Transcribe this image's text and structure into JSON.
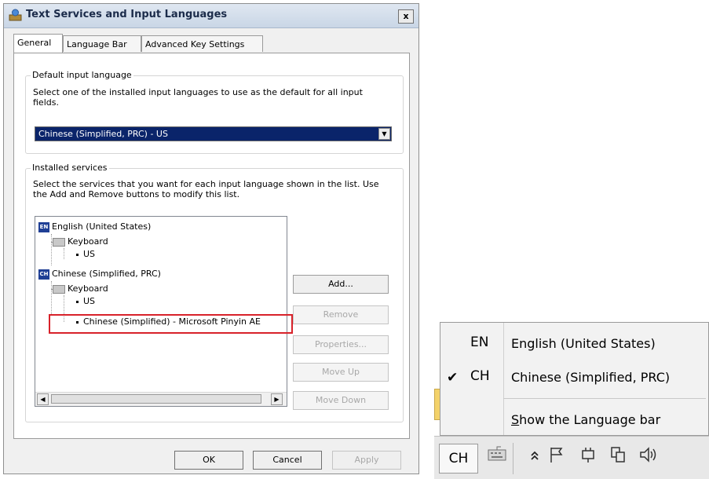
{
  "dialog": {
    "title": "Text Services and Input Languages",
    "close_glyph": "x",
    "tabs": [
      {
        "label": "General",
        "active": true
      },
      {
        "label": "Language Bar",
        "active": false
      },
      {
        "label": "Advanced Key Settings",
        "active": false
      }
    ],
    "default_input": {
      "group_title": "Default input language",
      "description": "Select one of the installed input languages to use as the default for all input fields.",
      "selected_value": "Chinese (Simplified, PRC) - US"
    },
    "installed_services": {
      "group_title": "Installed services",
      "description": "Select the services that you want for each input language shown in the list. Use the Add and Remove buttons to modify this list.",
      "tree": [
        {
          "badge": "EN",
          "language": "English (United States)",
          "keyboard_label": "Keyboard",
          "layouts": [
            "US"
          ]
        },
        {
          "badge": "CH",
          "language": "Chinese (Simplified, PRC)",
          "keyboard_label": "Keyboard",
          "layouts": [
            "US",
            "Chinese (Simplified) - Microsoft Pinyin AE"
          ]
        }
      ]
    },
    "buttons": {
      "add": "Add...",
      "remove": "Remove",
      "properties": "Properties...",
      "move_up": "Move Up",
      "move_down": "Move Down",
      "ok": "OK",
      "cancel": "Cancel",
      "apply": "Apply"
    }
  },
  "language_menu": {
    "items": [
      {
        "code": "EN",
        "label": "English (United States)",
        "checked": false
      },
      {
        "code": "CH",
        "label": "Chinese (Simplified, PRC)",
        "checked": true
      }
    ],
    "check_glyph": "✔",
    "show_bar": {
      "underlined": "S",
      "rest": "how the Language bar"
    }
  },
  "taskbar": {
    "language_code": "CH"
  },
  "colors": {
    "highlight_box": "#d8222a",
    "selection": "#0a246a",
    "badge": "#1f3f95"
  }
}
